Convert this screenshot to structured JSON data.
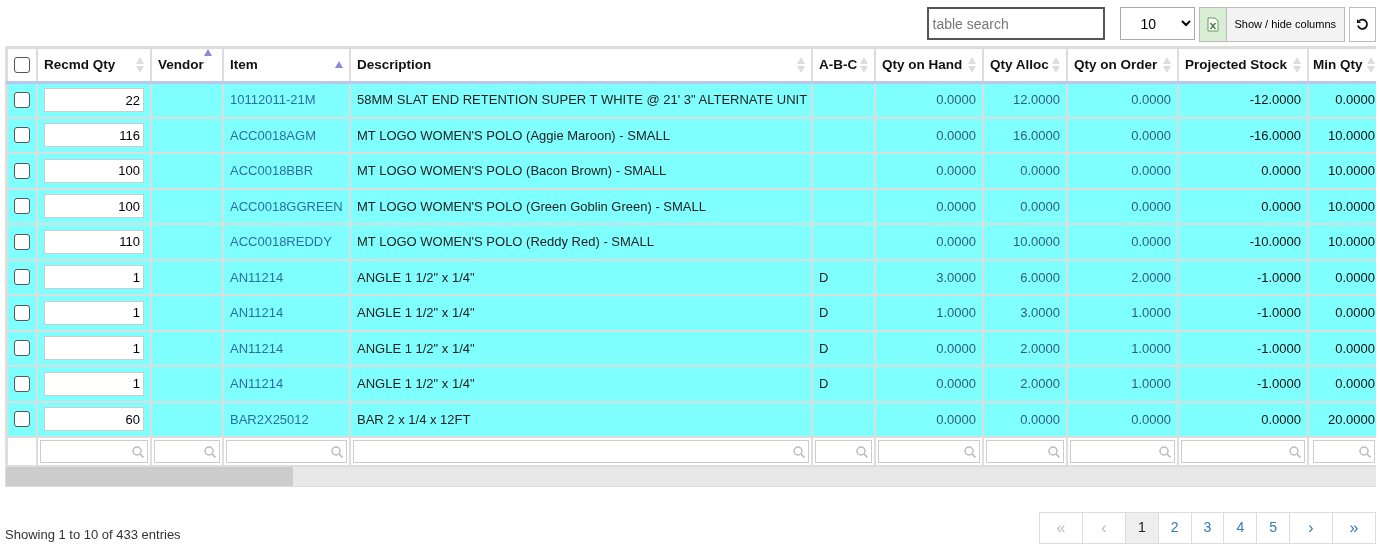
{
  "toolbar": {
    "search": {
      "placeholder": "table search"
    },
    "page_size": "10",
    "show_hide_button": "Show / hide columns"
  },
  "table": {
    "columns": [
      {
        "label": "Recmd Qty",
        "sorted": false
      },
      {
        "label": "Vendor",
        "sorted": true
      },
      {
        "label": "Item",
        "sorted": true
      },
      {
        "label": "Description",
        "sorted": false
      },
      {
        "label": "A-B-C",
        "sorted": false
      },
      {
        "label": "Qty on Hand",
        "sorted": false
      },
      {
        "label": "Qty Alloc",
        "sorted": false
      },
      {
        "label": "Qty on Order",
        "sorted": false
      },
      {
        "label": "Projected Stock",
        "sorted": false
      },
      {
        "label": "Min Qty",
        "sorted": false
      }
    ],
    "select_all_checked": false,
    "rows": [
      {
        "checked": false,
        "recmd_qty": "22",
        "item": "10112011-21M",
        "description": "58MM SLAT END RETENTION SUPER T WHITE @ 21' 3\" ALTERNATE UNIT",
        "on_hand": "0.0000",
        "alloc": "12.0000",
        "on_order": "0.0000",
        "projected": "-12.0000",
        "min_qty": "0.0000"
      },
      {
        "checked": false,
        "recmd_qty": "116",
        "item": "ACC0018AGM",
        "description": "MT LOGO WOMEN'S POLO (Aggie Maroon) - SMALL",
        "on_hand": "0.0000",
        "alloc": "16.0000",
        "on_order": "0.0000",
        "projected": "-16.0000",
        "min_qty": "10.0000"
      },
      {
        "checked": false,
        "recmd_qty": "100",
        "item": "ACC0018BBR",
        "description": "MT LOGO WOMEN'S POLO (Bacon Brown) - SMALL",
        "on_hand": "0.0000",
        "alloc": "0.0000",
        "on_order": "0.0000",
        "projected": "0.0000",
        "min_qty": "10.0000"
      },
      {
        "checked": false,
        "recmd_qty": "100",
        "item": "ACC0018GGREEN",
        "description": "MT LOGO WOMEN'S POLO (Green Goblin Green) - SMALL",
        "on_hand": "0.0000",
        "alloc": "0.0000",
        "on_order": "0.0000",
        "projected": "0.0000",
        "min_qty": "10.0000"
      },
      {
        "checked": false,
        "recmd_qty": "110",
        "item": "ACC0018REDDY",
        "description": "MT LOGO WOMEN'S POLO (Reddy Red) - SMALL",
        "on_hand": "0.0000",
        "alloc": "10.0000",
        "on_order": "0.0000",
        "projected": "-10.0000",
        "min_qty": "10.0000"
      },
      {
        "checked": false,
        "recmd_qty": "1",
        "item": "AN11214",
        "description": "ANGLE 1 1/2\" x 1/4\"",
        "abc": "D",
        "on_hand": "3.0000",
        "alloc": "6.0000",
        "on_order": "2.0000",
        "projected": "-1.0000",
        "min_qty": "0.0000"
      },
      {
        "checked": false,
        "recmd_qty": "1",
        "item": "AN11214",
        "description": "ANGLE 1 1/2\" x 1/4\"",
        "abc": "D",
        "on_hand": "1.0000",
        "alloc": "3.0000",
        "on_order": "1.0000",
        "projected": "-1.0000",
        "min_qty": "0.0000"
      },
      {
        "checked": false,
        "recmd_qty": "1",
        "item": "AN11214",
        "description": "ANGLE 1 1/2\" x 1/4\"",
        "abc": "D",
        "on_hand": "0.0000",
        "alloc": "2.0000",
        "on_order": "1.0000",
        "projected": "-1.0000",
        "min_qty": "0.0000"
      },
      {
        "checked": false,
        "recmd_qty": "1",
        "item": "AN11214",
        "description": "ANGLE 1 1/2\" x 1/4\"",
        "abc": "D",
        "on_hand": "0.0000",
        "alloc": "2.0000",
        "on_order": "1.0000",
        "projected": "-1.0000",
        "min_qty": "0.0000"
      },
      {
        "checked": false,
        "recmd_qty": "60",
        "item": "BAR2X25012",
        "description": "BAR 2 x 1/4 x 12FT",
        "on_hand": "0.0000",
        "alloc": "0.0000",
        "on_order": "0.0000",
        "projected": "0.0000",
        "min_qty": "20.0000"
      }
    ]
  },
  "info": "Showing 1 to 10 of 433 entries",
  "pagination": [
    {
      "label": "«",
      "kind": "nav",
      "selected": false,
      "disabled": true
    },
    {
      "label": "‹",
      "kind": "nav",
      "selected": false,
      "disabled": true
    },
    {
      "label": "1",
      "kind": "page",
      "selected": true,
      "disabled": false
    },
    {
      "label": "2",
      "kind": "page",
      "selected": false,
      "disabled": false
    },
    {
      "label": "3",
      "kind": "page",
      "selected": false,
      "disabled": false
    },
    {
      "label": "4",
      "kind": "page",
      "selected": false,
      "disabled": false
    },
    {
      "label": "5",
      "kind": "page",
      "selected": false,
      "disabled": false
    },
    {
      "label": "›",
      "kind": "nav",
      "selected": false,
      "disabled": false
    },
    {
      "label": "»",
      "kind": "nav",
      "selected": false,
      "disabled": false
    }
  ]
}
